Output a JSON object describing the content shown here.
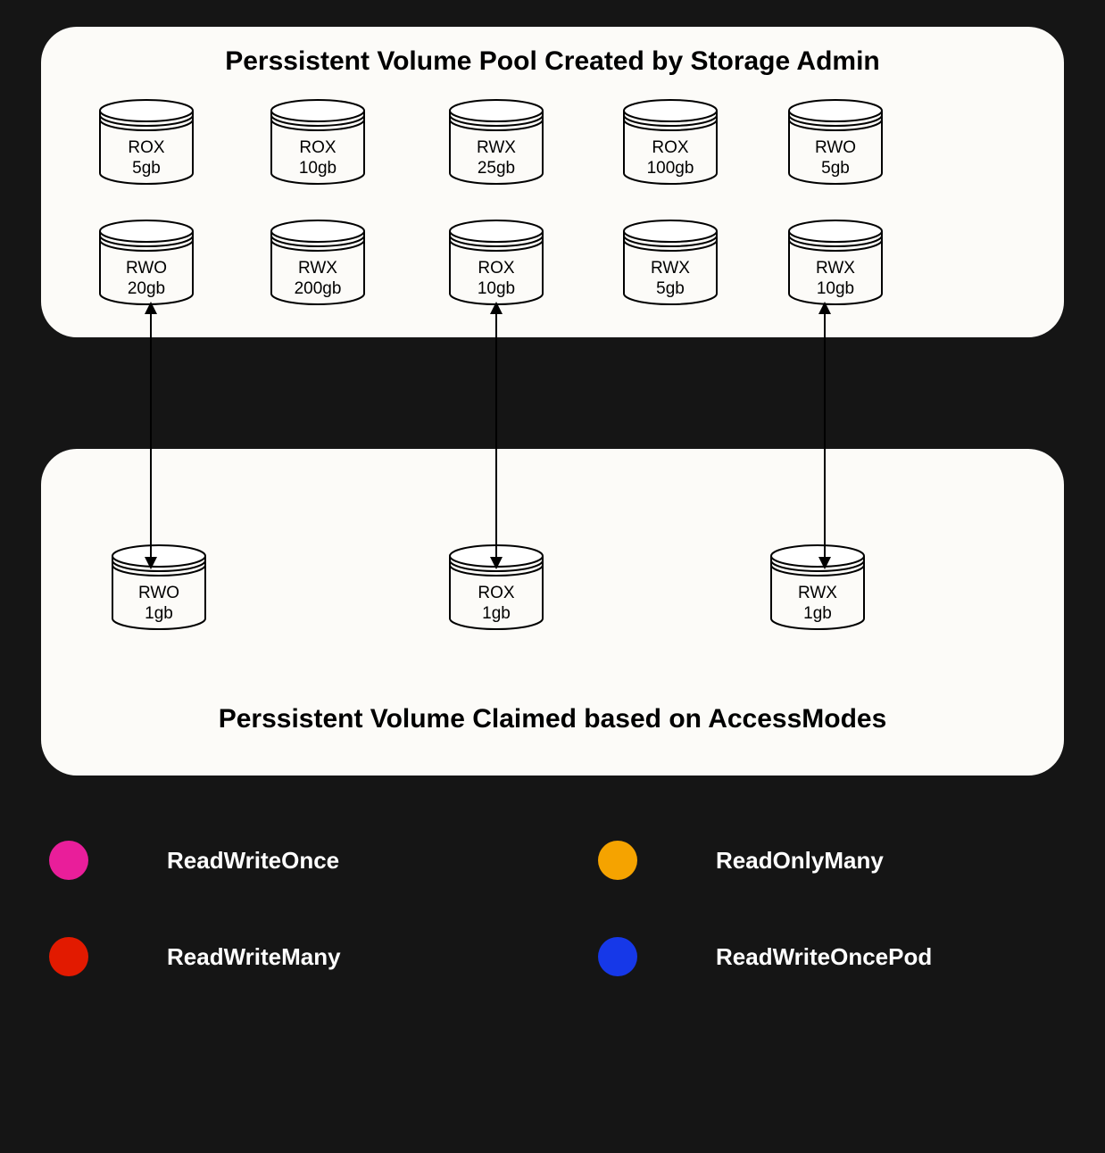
{
  "pool": {
    "title": "Perssistent Volume Pool Created by Storage Admin",
    "volumes": [
      {
        "mode": "ROX",
        "size": "5gb"
      },
      {
        "mode": "ROX",
        "size": "10gb"
      },
      {
        "mode": "RWX",
        "size": "25gb"
      },
      {
        "mode": "ROX",
        "size": "100gb"
      },
      {
        "mode": "RWO",
        "size": "5gb"
      },
      {
        "mode": "RWO",
        "size": "20gb"
      },
      {
        "mode": "RWX",
        "size": "200gb"
      },
      {
        "mode": "ROX",
        "size": "10gb"
      },
      {
        "mode": "RWX",
        "size": "5gb"
      },
      {
        "mode": "RWX",
        "size": "10gb"
      }
    ]
  },
  "claims": {
    "title": "Perssistent Volume Claimed based on AccessModes",
    "volumes": [
      {
        "mode": "RWO",
        "size": "1gb"
      },
      {
        "mode": "ROX",
        "size": "1gb"
      },
      {
        "mode": "RWX",
        "size": "1gb"
      }
    ]
  },
  "bindings": [
    {
      "pool_index": 5,
      "claim_index": 0
    },
    {
      "pool_index": 7,
      "claim_index": 1
    },
    {
      "pool_index": 9,
      "claim_index": 2
    }
  ],
  "legend": [
    {
      "color": "#e91e9a",
      "label": "ReadWriteOnce"
    },
    {
      "color": "#f5a300",
      "label": "ReadOnlyMany"
    },
    {
      "color": "#e21a00",
      "label": "ReadWriteMany"
    },
    {
      "color": "#1638e8",
      "label": "ReadWriteOncePod"
    }
  ]
}
